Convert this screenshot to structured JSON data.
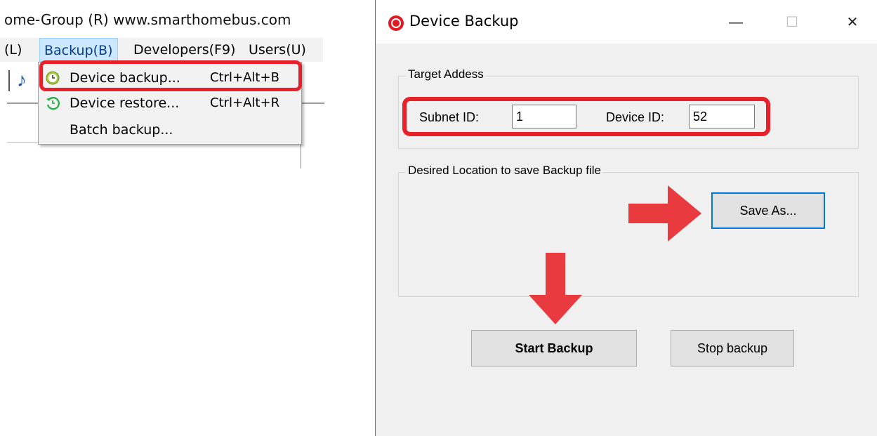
{
  "main_app": {
    "title": "ome-Group (R)  www.smarthomebus.com",
    "menu": [
      {
        "label": "(L)"
      },
      {
        "label": "Backup(B)"
      },
      {
        "label": "Developers(F9)"
      },
      {
        "label": "Users(U)"
      }
    ],
    "dropdown": [
      {
        "label": "Device backup...",
        "shortcut": "Ctrl+Alt+B",
        "icon": "backup-clock-icon"
      },
      {
        "label": "Device restore...",
        "shortcut": "Ctrl+Alt+R",
        "icon": "restore-clock-icon"
      },
      {
        "label": "Batch backup...",
        "shortcut": "",
        "icon": ""
      }
    ]
  },
  "dialog": {
    "title": "Device Backup",
    "controls": {
      "minimize": "—",
      "maximize": "☐",
      "close": "✕"
    },
    "target_group": {
      "legend": "Target Addess",
      "subnet_label": "Subnet ID:",
      "subnet_value": "1",
      "device_label": "Device ID:",
      "device_value": "52"
    },
    "location_group": {
      "legend": "Desired Location to save Backup file",
      "save_as_label": "Save As..."
    },
    "buttons": {
      "start": "Start Backup",
      "stop": "Stop backup"
    }
  },
  "colors": {
    "highlight": "#e8202a",
    "arrow": "#e83a3f",
    "menu_active_bg": "#cce8ff",
    "focus_border": "#0078d7"
  }
}
